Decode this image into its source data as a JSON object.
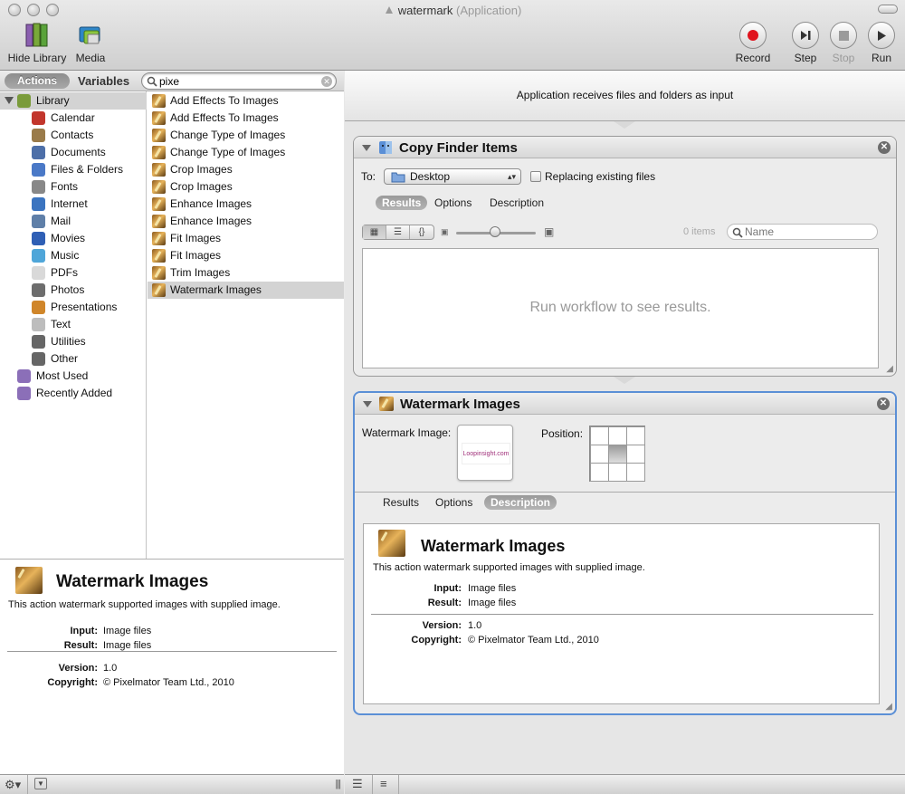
{
  "window": {
    "title": "watermark",
    "subtitle": "(Application)"
  },
  "toolbar": {
    "hide_library": "Hide Library",
    "media": "Media",
    "record": "Record",
    "step": "Step",
    "stop": "Stop",
    "run": "Run"
  },
  "library": {
    "tab_actions": "Actions",
    "tab_variables": "Variables",
    "search_value": "pixe",
    "categories": [
      {
        "label": "Library",
        "icon": "library-icon",
        "color": "#7a9b3a"
      },
      {
        "label": "Calendar",
        "icon": "calendar-icon",
        "color": "#c2362c"
      },
      {
        "label": "Contacts",
        "icon": "contacts-icon",
        "color": "#9a7b4a"
      },
      {
        "label": "Documents",
        "icon": "documents-icon",
        "color": "#4d6fa8"
      },
      {
        "label": "Files & Folders",
        "icon": "finder-icon",
        "color": "#4a79c7"
      },
      {
        "label": "Fonts",
        "icon": "fonts-icon",
        "color": "#888888"
      },
      {
        "label": "Internet",
        "icon": "internet-icon",
        "color": "#3b74c0"
      },
      {
        "label": "Mail",
        "icon": "mail-icon",
        "color": "#5f7fa8"
      },
      {
        "label": "Movies",
        "icon": "movies-icon",
        "color": "#2f5fb5"
      },
      {
        "label": "Music",
        "icon": "music-icon",
        "color": "#4fa6d9"
      },
      {
        "label": "PDFs",
        "icon": "pdf-icon",
        "color": "#d9d9d9"
      },
      {
        "label": "Photos",
        "icon": "photos-icon",
        "color": "#6d6d6d"
      },
      {
        "label": "Presentations",
        "icon": "presentations-icon",
        "color": "#d0862a"
      },
      {
        "label": "Text",
        "icon": "text-icon",
        "color": "#bdbdbd"
      },
      {
        "label": "Utilities",
        "icon": "utilities-icon",
        "color": "#666666"
      },
      {
        "label": "Other",
        "icon": "other-icon",
        "color": "#666666"
      },
      {
        "label": "Most Used",
        "icon": "smart-folder-icon",
        "color": "#8b6fb8"
      },
      {
        "label": "Recently Added",
        "icon": "smart-folder-icon",
        "color": "#8b6fb8"
      }
    ],
    "actions": [
      "Add Effects To Images",
      "Add Effects To Images",
      "Change Type of Images",
      "Change Type of Images",
      "Crop Images",
      "Crop Images",
      "Enhance Images",
      "Enhance Images",
      "Fit Images",
      "Fit Images",
      "Trim Images",
      "Watermark Images"
    ]
  },
  "description": {
    "title": "Watermark Images",
    "text": "This action watermark supported images with supplied image.",
    "input_label": "Input:",
    "input_value": "Image files",
    "result_label": "Result:",
    "result_value": "Image files",
    "version_label": "Version:",
    "version_value": "1.0",
    "copyright_label": "Copyright:",
    "copyright_value": "© Pixelmator Team Ltd., 2010"
  },
  "workflow": {
    "input_banner": "Application receives files and folders as input",
    "copy_finder": {
      "title": "Copy Finder Items",
      "to_label": "To:",
      "destination": "Desktop",
      "replacing_label": "Replacing existing files",
      "replacing_checked": false,
      "tabs": [
        "Results",
        "Options",
        "Description"
      ],
      "active_tab": "Results",
      "items_count": "0 items",
      "name_placeholder": "Name",
      "empty_message": "Run workflow to see results."
    },
    "watermark": {
      "title": "Watermark Images",
      "watermark_label": "Watermark Image:",
      "watermark_image_text": "Loopinsight.com",
      "position_label": "Position:",
      "position_selected": "center",
      "tabs": [
        "Results",
        "Options",
        "Description"
      ],
      "active_tab": "Description"
    }
  },
  "colors": {
    "selection_blue": "#5b8fd6",
    "record_red": "#e0141e"
  }
}
